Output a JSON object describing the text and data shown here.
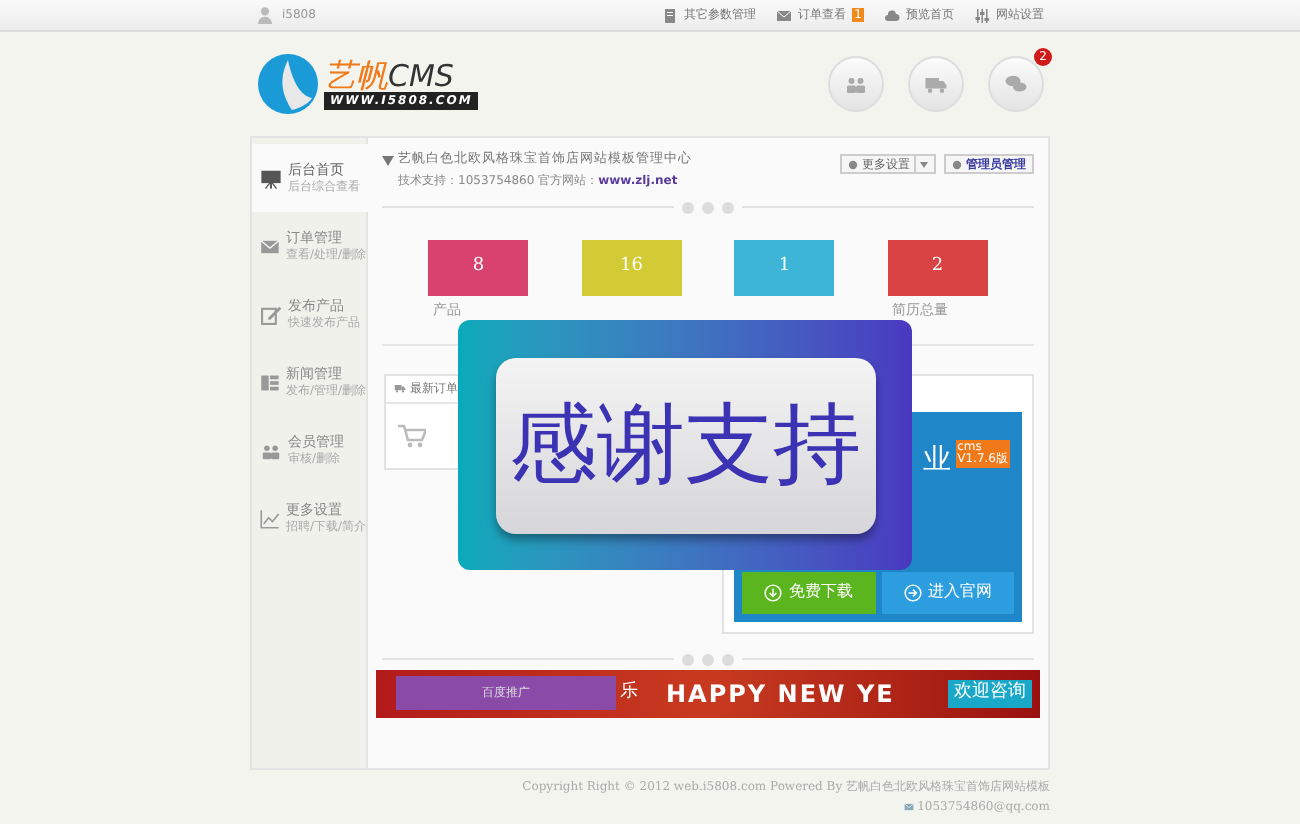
{
  "top_bar": {
    "user": "i5808",
    "links": [
      {
        "kind": "doc",
        "label": "其它参数管理"
      },
      {
        "kind": "mail",
        "label": "订单查看",
        "badge": "1"
      },
      {
        "kind": "cloud",
        "label": "预览首页"
      },
      {
        "kind": "sliders",
        "label": "网站设置"
      }
    ]
  },
  "header": {
    "logo": {
      "name_cn": "艺帆",
      "name_en": "CMS",
      "url": "WWW.I5808.COM"
    },
    "circle_buttons": [
      {
        "kind": "people"
      },
      {
        "kind": "truck"
      },
      {
        "kind": "chat",
        "badge": "2"
      }
    ]
  },
  "sidebar": {
    "items": [
      {
        "kind": "board",
        "title": "后台首页",
        "subtitle": "后台综合查看",
        "selected": true
      },
      {
        "kind": "mail",
        "title": "订单管理",
        "subtitle": "查看/处理/删除",
        "selected": false
      },
      {
        "kind": "edit",
        "title": "发布产品",
        "subtitle": "快速发布产品",
        "selected": false
      },
      {
        "kind": "news",
        "title": "新闻管理",
        "subtitle": "发布/管理/删除",
        "selected": false
      },
      {
        "kind": "people",
        "title": "会员管理",
        "subtitle": "审核/删除",
        "selected": false
      },
      {
        "kind": "chart",
        "title": "更多设置",
        "subtitle": "招聘/下载/简介",
        "selected": false
      }
    ]
  },
  "site": {
    "title": "艺帆白色北欧风格珠宝首饰店网站模板管理中心",
    "support": "技术支持：1053754860 官方网站：",
    "link": "www.zlj.net",
    "more_button": "更多设置",
    "admin_button": "管理员管理"
  },
  "stats": [
    {
      "value": "8",
      "label": "产品",
      "color": "#d9426e"
    },
    {
      "value": "16",
      "color": "#d3cb36"
    },
    {
      "value": "1",
      "color": "#3db5d6"
    },
    {
      "value": "2",
      "label": "简历总量",
      "color": "#d94343"
    }
  ],
  "orders": {
    "title": "最新订单"
  },
  "promo": {
    "heading": "业",
    "badge_top": "cms",
    "badge_version": "V1.7.6版",
    "buttons": [
      {
        "kind": "download",
        "label": "免费下载"
      },
      {
        "kind": "enter",
        "label": "进入官网"
      }
    ]
  },
  "banner": {
    "ad_label": "百度推广",
    "left_char": "乐",
    "text": "HAPPY NEW YE",
    "side_text": "欢迎咨询"
  },
  "footer": {
    "copyright": "Copyright Right © 2012 web.i5808.com Powered By 艺帆白色北欧风格珠宝首饰店网站模板",
    "email": "1053754860@qq.com"
  },
  "overlay": {
    "text": "感谢支持"
  }
}
